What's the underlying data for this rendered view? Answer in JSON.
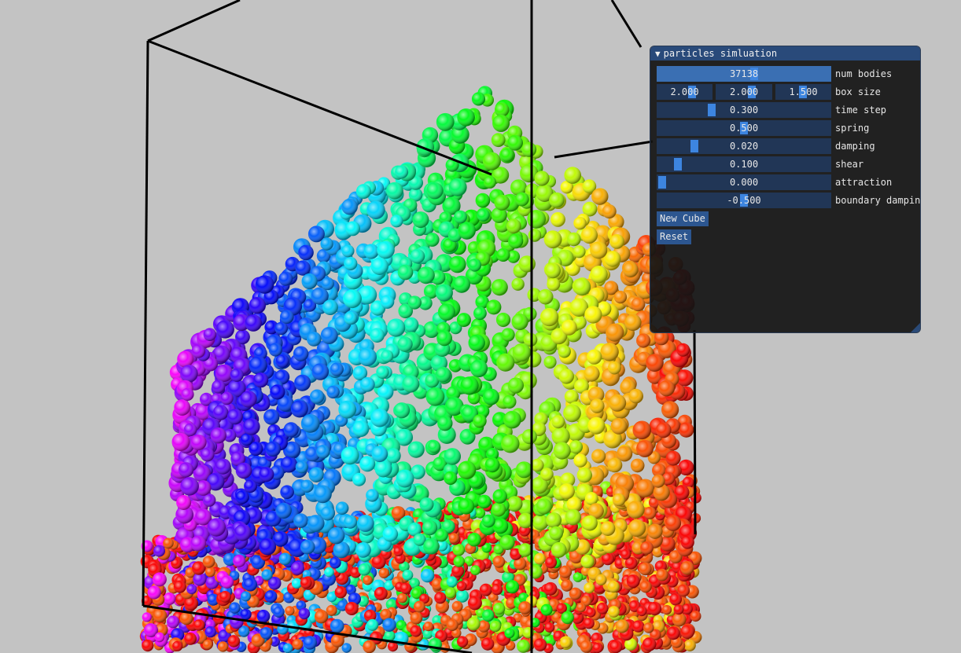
{
  "window": {
    "title": "particles simluation",
    "collapse_icon": "triangle-down-icon"
  },
  "controls": {
    "num_bodies": {
      "label": "num bodies",
      "value": "37138",
      "fraction": 0.53
    },
    "box_size": {
      "label": "box size",
      "values": [
        "2.000",
        "2.000",
        "1.500"
      ],
      "fractions": [
        0.5,
        0.5,
        0.37
      ]
    },
    "time_step": {
      "label": "time step",
      "value": "0.300",
      "fraction": 0.3
    },
    "spring": {
      "label": "spring",
      "value": "0.500",
      "fraction": 0.5
    },
    "damping": {
      "label": "damping",
      "value": "0.020",
      "fraction": 0.2
    },
    "shear": {
      "label": "shear",
      "value": "0.100",
      "fraction": 0.1
    },
    "attraction": {
      "label": "attraction",
      "value": "0.000",
      "fraction": 0.0
    },
    "boundary_damping": {
      "label": "boundary dampin",
      "value": "-0.500",
      "fraction": 0.5
    }
  },
  "buttons": {
    "new_cube": "New Cube",
    "reset": "Reset"
  },
  "colors": {
    "background": "#c3c3c3",
    "panel_bg": "#141414",
    "title_bar": "#294a7a",
    "slider_frame": "#213656",
    "slider_grab": "#3d85e0",
    "button": "#2c5690"
  }
}
